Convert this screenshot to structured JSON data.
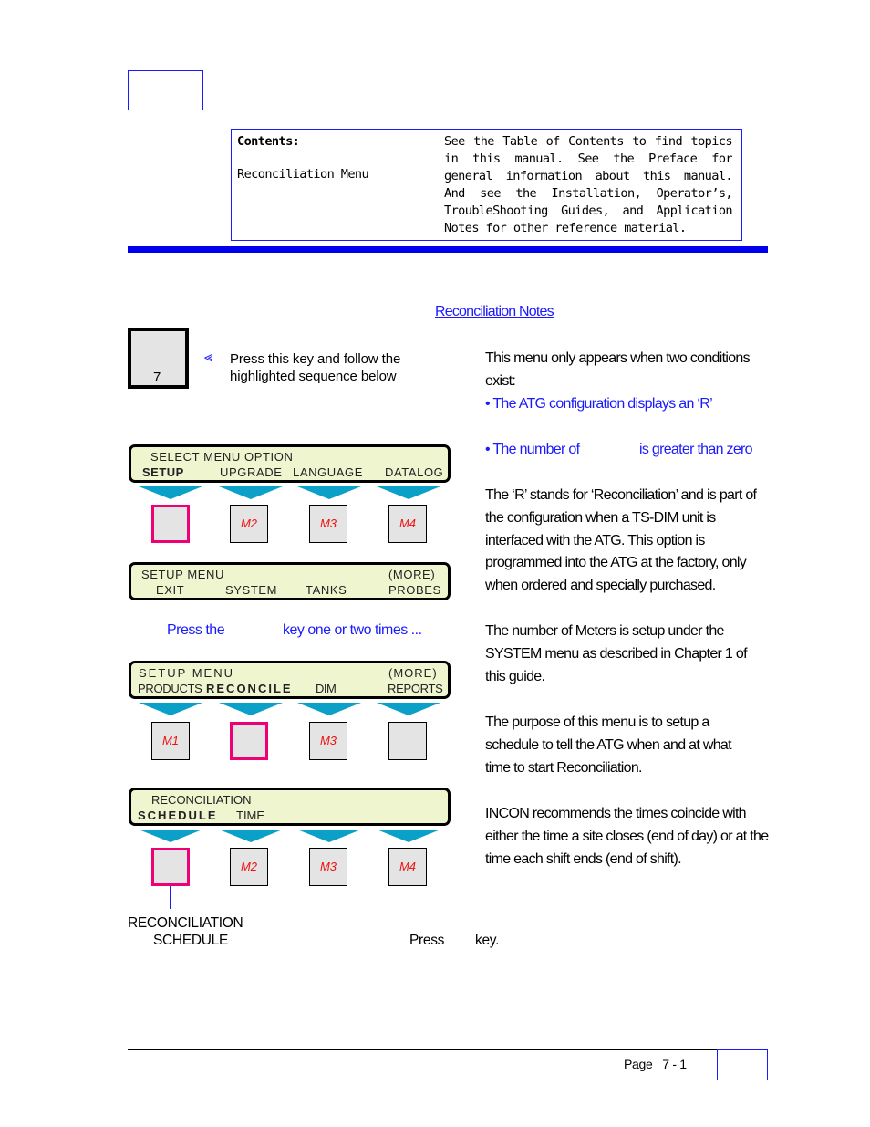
{
  "header": {
    "contents_title": "Contents:",
    "contents_item": "Reconciliation Menu",
    "contents_description": "See the Table of Contents to find topics in this manual.  See the Preface for general information about this manual.  And see the Installation, Operator’s, TroubleShooting Guides, and Application Notes for other reference material."
  },
  "notes_link": "Reconciliation Notes",
  "intro": {
    "key_label": "7",
    "instruction": "Press this key and follow the highlighted sequence below"
  },
  "screens": [
    {
      "line1": "SELECT MENU OPTION",
      "line2": [
        "SETUP",
        "UPGRADE",
        "LANGUAGE",
        "DATALOG"
      ],
      "keys": [
        "",
        "M2",
        "M3",
        "M4"
      ],
      "highlighted_key": 1
    },
    {
      "line1": "SETUP MENU",
      "line1_right": "(MORE)",
      "line2": [
        "EXIT",
        "SYSTEM",
        "TANKS",
        "PROBES"
      ]
    },
    {
      "line1": "SETUP MENU",
      "line1_right": "(MORE)",
      "line2": [
        "PRODUCTS",
        "RECONCILE",
        "DIM",
        "REPORTS"
      ],
      "keys": [
        "M1",
        "",
        "M3",
        ""
      ],
      "highlighted_key": 2
    },
    {
      "line1": "RECONCILIATION",
      "line2": [
        "SCHEDULE",
        "TIME"
      ],
      "keys": [
        "",
        "M2",
        "M3",
        "M4"
      ],
      "highlighted_key": 1
    }
  ],
  "press_more": {
    "before": "Press the",
    "after": "key one or two times ..."
  },
  "caption": {
    "line1": "RECONCILIATION",
    "line2": "SCHEDULE",
    "press": "Press",
    "key": "key."
  },
  "right_column": {
    "p1": "This menu only appears when two conditions exist:",
    "bullet1": "• The ATG configuration displays an ‘R’",
    "bullet2_before": "• The number of",
    "bullet2_after": "is greater than zero",
    "p2": "The ‘R’ stands for ‘Reconciliation’ and is part of the configuration when a TS-DIM unit is interfaced with the ATG. This option is programmed into the ATG at the factory, only when ordered and specially purchased.",
    "p3": "The number of Meters is setup under the SYSTEM menu as described in Chapter 1 of this guide.",
    "p4": "The purpose of this menu is to setup a schedule to tell the ATG when and at what time to start Reconciliation.",
    "p5": "INCON recommends the times coincide with either the time a site closes (end of day) or at the time each shift ends (end of shift)."
  },
  "footer": {
    "page_label": "Page",
    "page_number": "7 - 1"
  },
  "colors": {
    "accent_blue": "#1a1aff",
    "highlight_key": "#ee0077",
    "lcd_background": "#eef5cf",
    "arrow": "#0aa0c8",
    "key_label": "#ee1111"
  }
}
